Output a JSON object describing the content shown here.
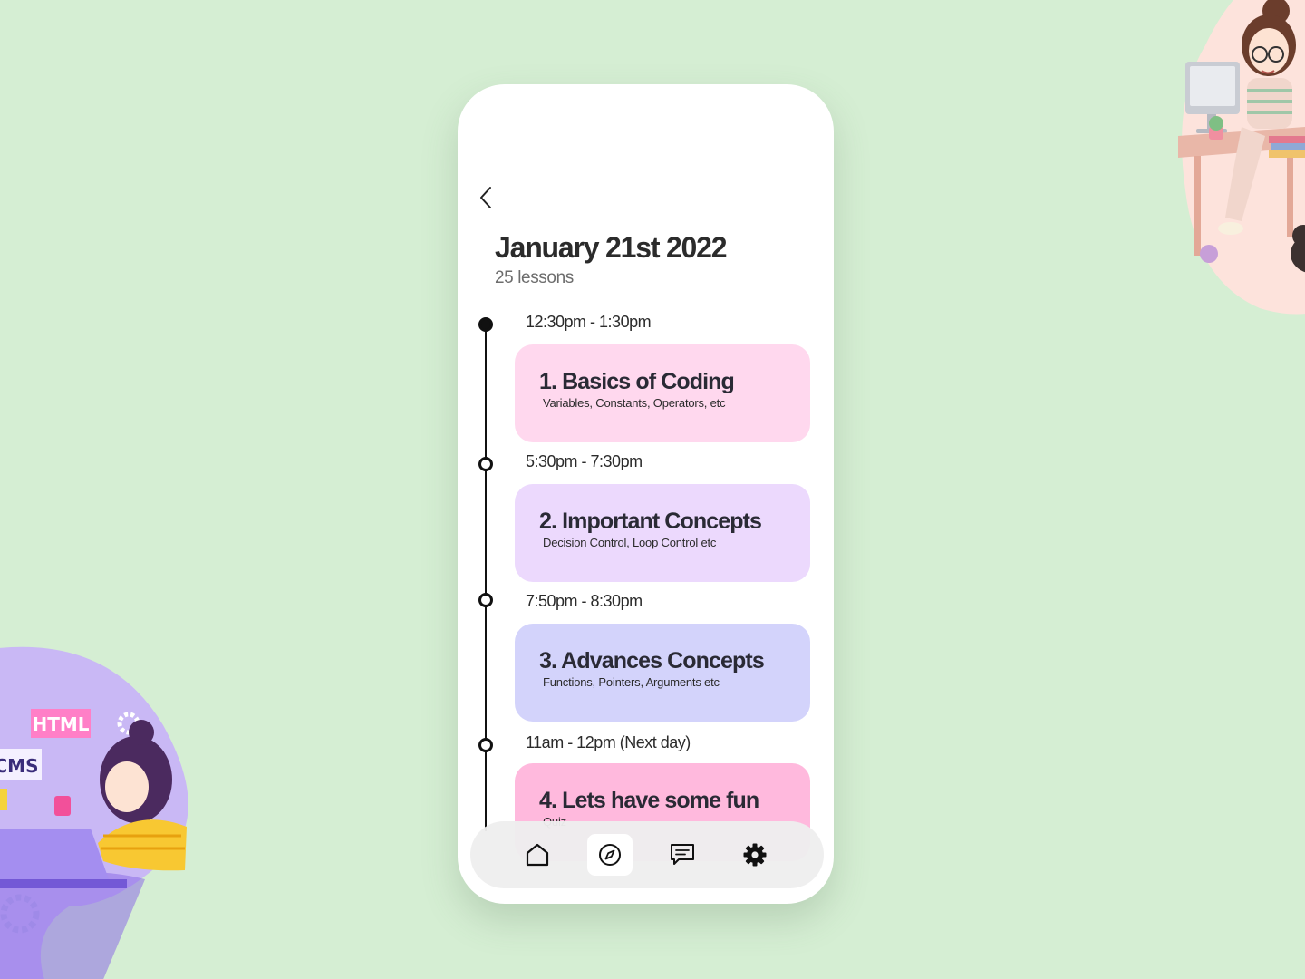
{
  "header": {
    "title": "January 21st 2022",
    "subtitle": "25 lessons"
  },
  "lessons": [
    {
      "time": "12:30pm - 1:30pm",
      "title": "1. Basics of Coding",
      "description": "Variables, Constants, Operators,  etc",
      "color": "#ffd8ee",
      "marker": "filled"
    },
    {
      "time": "5:30pm - 7:30pm",
      "title": "2. Important Concepts",
      "description": "Decision Control, Loop Control etc",
      "color": "#ecd9fd",
      "marker": "hollow"
    },
    {
      "time": "7:50pm - 8:30pm",
      "title": "3. Advances Concepts",
      "description": "Functions, Pointers, Arguments etc",
      "color": "#d3d3fb",
      "marker": "hollow"
    },
    {
      "time": "11am - 12pm (Next day)",
      "title": "4. Lets have some fun",
      "description": "Quiz",
      "color": "#ffb9dd",
      "marker": "hollow"
    }
  ],
  "bottom_nav": {
    "items": [
      "home-icon",
      "compass-icon",
      "chat-icon",
      "gear-icon"
    ],
    "active": "compass-icon"
  },
  "illustration_text": {
    "html_tag": "HTML",
    "cms_tag": "CMS",
    "code_tag": "</>"
  },
  "colors": {
    "background": "#d5eed3",
    "phone": "#ffffff",
    "nav_bg": "#eeeeee",
    "accent_dark": "#111111"
  }
}
